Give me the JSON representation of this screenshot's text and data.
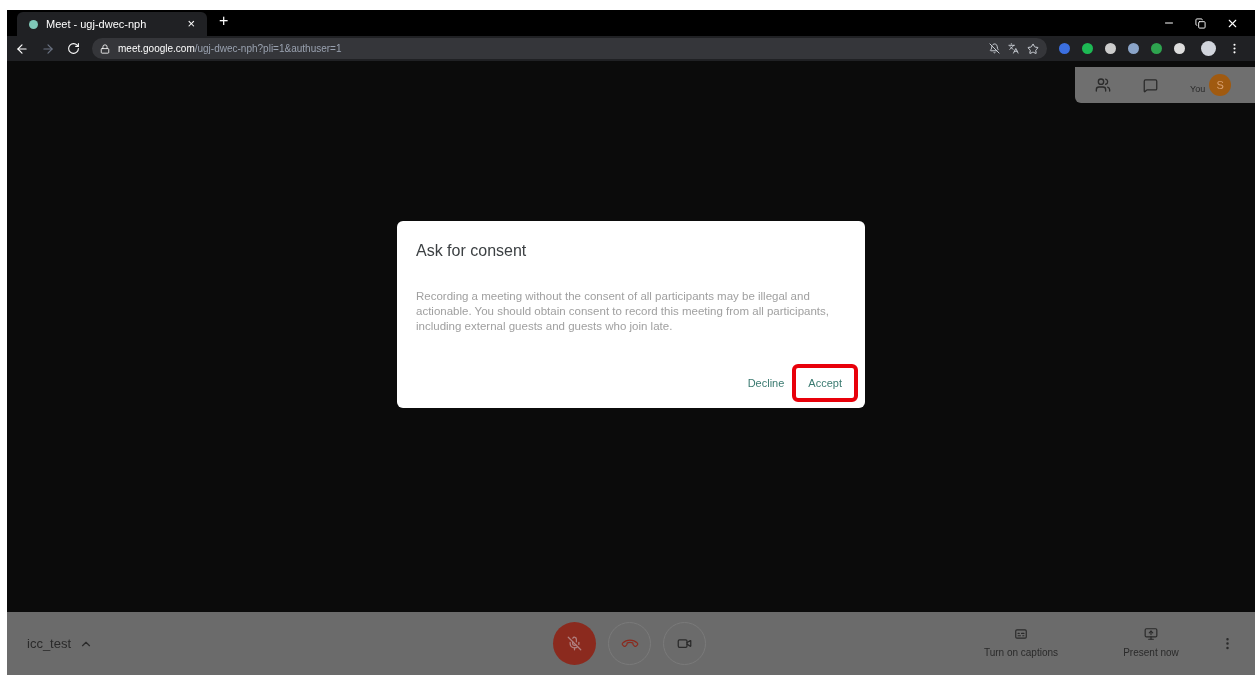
{
  "tab": {
    "title": "Meet - ugj-dwec-nph",
    "close": "×",
    "new_tab": "+"
  },
  "address": {
    "domain": "meet.google.com",
    "path": "/ugj-dwec-nph?pli=1&authuser=1"
  },
  "panel": {
    "avatar_initial": "S",
    "you_label": "You"
  },
  "dialog": {
    "title": "Ask for consent",
    "body": "Recording a meeting without the consent of all participants may be illegal and actionable. You should obtain consent to record this meeting from all participants, including external guests and guests who join late.",
    "buttons": [
      {
        "label": "Decline",
        "highlighted": false
      },
      {
        "label": "Accept",
        "highlighted": true
      }
    ]
  },
  "bottom_bar": {
    "meeting_name": "icc_test",
    "mic_muted": true,
    "actions": [
      {
        "label": "Turn on captions",
        "kind": "captions"
      },
      {
        "label": "Present now",
        "kind": "present"
      }
    ]
  }
}
